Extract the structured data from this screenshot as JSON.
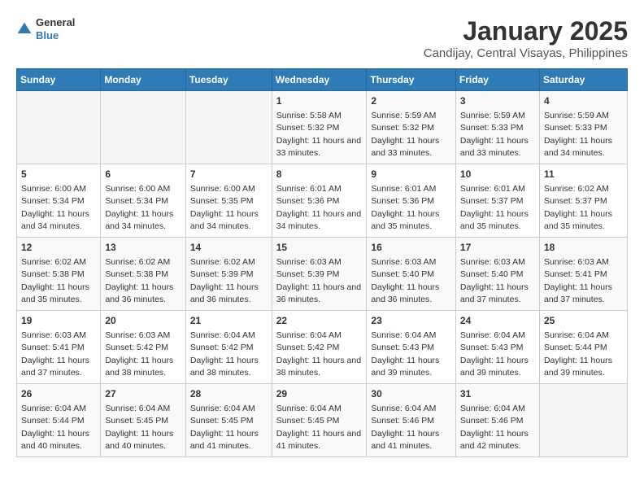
{
  "logo": {
    "line1": "General",
    "line2": "Blue"
  },
  "title": "January 2025",
  "subtitle": "Candijay, Central Visayas, Philippines",
  "days_of_week": [
    "Sunday",
    "Monday",
    "Tuesday",
    "Wednesday",
    "Thursday",
    "Friday",
    "Saturday"
  ],
  "weeks": [
    [
      {
        "day": "",
        "sunrise": "",
        "sunset": "",
        "daylight": ""
      },
      {
        "day": "",
        "sunrise": "",
        "sunset": "",
        "daylight": ""
      },
      {
        "day": "",
        "sunrise": "",
        "sunset": "",
        "daylight": ""
      },
      {
        "day": "1",
        "sunrise": "Sunrise: 5:58 AM",
        "sunset": "Sunset: 5:32 PM",
        "daylight": "Daylight: 11 hours and 33 minutes."
      },
      {
        "day": "2",
        "sunrise": "Sunrise: 5:59 AM",
        "sunset": "Sunset: 5:32 PM",
        "daylight": "Daylight: 11 hours and 33 minutes."
      },
      {
        "day": "3",
        "sunrise": "Sunrise: 5:59 AM",
        "sunset": "Sunset: 5:33 PM",
        "daylight": "Daylight: 11 hours and 33 minutes."
      },
      {
        "day": "4",
        "sunrise": "Sunrise: 5:59 AM",
        "sunset": "Sunset: 5:33 PM",
        "daylight": "Daylight: 11 hours and 34 minutes."
      }
    ],
    [
      {
        "day": "5",
        "sunrise": "Sunrise: 6:00 AM",
        "sunset": "Sunset: 5:34 PM",
        "daylight": "Daylight: 11 hours and 34 minutes."
      },
      {
        "day": "6",
        "sunrise": "Sunrise: 6:00 AM",
        "sunset": "Sunset: 5:34 PM",
        "daylight": "Daylight: 11 hours and 34 minutes."
      },
      {
        "day": "7",
        "sunrise": "Sunrise: 6:00 AM",
        "sunset": "Sunset: 5:35 PM",
        "daylight": "Daylight: 11 hours and 34 minutes."
      },
      {
        "day": "8",
        "sunrise": "Sunrise: 6:01 AM",
        "sunset": "Sunset: 5:36 PM",
        "daylight": "Daylight: 11 hours and 34 minutes."
      },
      {
        "day": "9",
        "sunrise": "Sunrise: 6:01 AM",
        "sunset": "Sunset: 5:36 PM",
        "daylight": "Daylight: 11 hours and 35 minutes."
      },
      {
        "day": "10",
        "sunrise": "Sunrise: 6:01 AM",
        "sunset": "Sunset: 5:37 PM",
        "daylight": "Daylight: 11 hours and 35 minutes."
      },
      {
        "day": "11",
        "sunrise": "Sunrise: 6:02 AM",
        "sunset": "Sunset: 5:37 PM",
        "daylight": "Daylight: 11 hours and 35 minutes."
      }
    ],
    [
      {
        "day": "12",
        "sunrise": "Sunrise: 6:02 AM",
        "sunset": "Sunset: 5:38 PM",
        "daylight": "Daylight: 11 hours and 35 minutes."
      },
      {
        "day": "13",
        "sunrise": "Sunrise: 6:02 AM",
        "sunset": "Sunset: 5:38 PM",
        "daylight": "Daylight: 11 hours and 36 minutes."
      },
      {
        "day": "14",
        "sunrise": "Sunrise: 6:02 AM",
        "sunset": "Sunset: 5:39 PM",
        "daylight": "Daylight: 11 hours and 36 minutes."
      },
      {
        "day": "15",
        "sunrise": "Sunrise: 6:03 AM",
        "sunset": "Sunset: 5:39 PM",
        "daylight": "Daylight: 11 hours and 36 minutes."
      },
      {
        "day": "16",
        "sunrise": "Sunrise: 6:03 AM",
        "sunset": "Sunset: 5:40 PM",
        "daylight": "Daylight: 11 hours and 36 minutes."
      },
      {
        "day": "17",
        "sunrise": "Sunrise: 6:03 AM",
        "sunset": "Sunset: 5:40 PM",
        "daylight": "Daylight: 11 hours and 37 minutes."
      },
      {
        "day": "18",
        "sunrise": "Sunrise: 6:03 AM",
        "sunset": "Sunset: 5:41 PM",
        "daylight": "Daylight: 11 hours and 37 minutes."
      }
    ],
    [
      {
        "day": "19",
        "sunrise": "Sunrise: 6:03 AM",
        "sunset": "Sunset: 5:41 PM",
        "daylight": "Daylight: 11 hours and 37 minutes."
      },
      {
        "day": "20",
        "sunrise": "Sunrise: 6:03 AM",
        "sunset": "Sunset: 5:42 PM",
        "daylight": "Daylight: 11 hours and 38 minutes."
      },
      {
        "day": "21",
        "sunrise": "Sunrise: 6:04 AM",
        "sunset": "Sunset: 5:42 PM",
        "daylight": "Daylight: 11 hours and 38 minutes."
      },
      {
        "day": "22",
        "sunrise": "Sunrise: 6:04 AM",
        "sunset": "Sunset: 5:42 PM",
        "daylight": "Daylight: 11 hours and 38 minutes."
      },
      {
        "day": "23",
        "sunrise": "Sunrise: 6:04 AM",
        "sunset": "Sunset: 5:43 PM",
        "daylight": "Daylight: 11 hours and 39 minutes."
      },
      {
        "day": "24",
        "sunrise": "Sunrise: 6:04 AM",
        "sunset": "Sunset: 5:43 PM",
        "daylight": "Daylight: 11 hours and 39 minutes."
      },
      {
        "day": "25",
        "sunrise": "Sunrise: 6:04 AM",
        "sunset": "Sunset: 5:44 PM",
        "daylight": "Daylight: 11 hours and 39 minutes."
      }
    ],
    [
      {
        "day": "26",
        "sunrise": "Sunrise: 6:04 AM",
        "sunset": "Sunset: 5:44 PM",
        "daylight": "Daylight: 11 hours and 40 minutes."
      },
      {
        "day": "27",
        "sunrise": "Sunrise: 6:04 AM",
        "sunset": "Sunset: 5:45 PM",
        "daylight": "Daylight: 11 hours and 40 minutes."
      },
      {
        "day": "28",
        "sunrise": "Sunrise: 6:04 AM",
        "sunset": "Sunset: 5:45 PM",
        "daylight": "Daylight: 11 hours and 41 minutes."
      },
      {
        "day": "29",
        "sunrise": "Sunrise: 6:04 AM",
        "sunset": "Sunset: 5:45 PM",
        "daylight": "Daylight: 11 hours and 41 minutes."
      },
      {
        "day": "30",
        "sunrise": "Sunrise: 6:04 AM",
        "sunset": "Sunset: 5:46 PM",
        "daylight": "Daylight: 11 hours and 41 minutes."
      },
      {
        "day": "31",
        "sunrise": "Sunrise: 6:04 AM",
        "sunset": "Sunset: 5:46 PM",
        "daylight": "Daylight: 11 hours and 42 minutes."
      },
      {
        "day": "",
        "sunrise": "",
        "sunset": "",
        "daylight": ""
      }
    ]
  ]
}
